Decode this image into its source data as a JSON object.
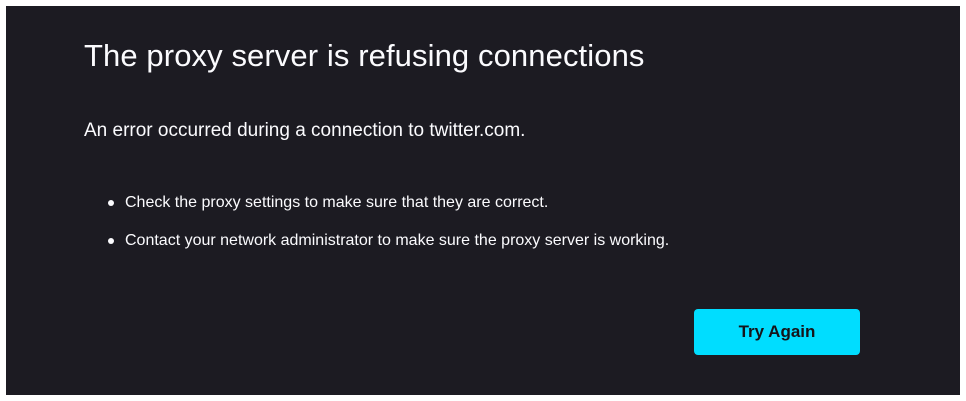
{
  "error_page": {
    "title": "The proxy server is refusing connections",
    "description": "An error occurred during a connection to twitter.com.",
    "suggestions": [
      "Check the proxy settings to make sure that they are correct.",
      "Contact your network administrator to make sure the proxy server is working."
    ],
    "try_again_label": "Try Again"
  },
  "colors": {
    "page_background": "#ffffff",
    "panel_background": "#1c1b22",
    "text": "#fbfbfe",
    "button_background": "#00ddff",
    "button_text": "#15141a"
  }
}
